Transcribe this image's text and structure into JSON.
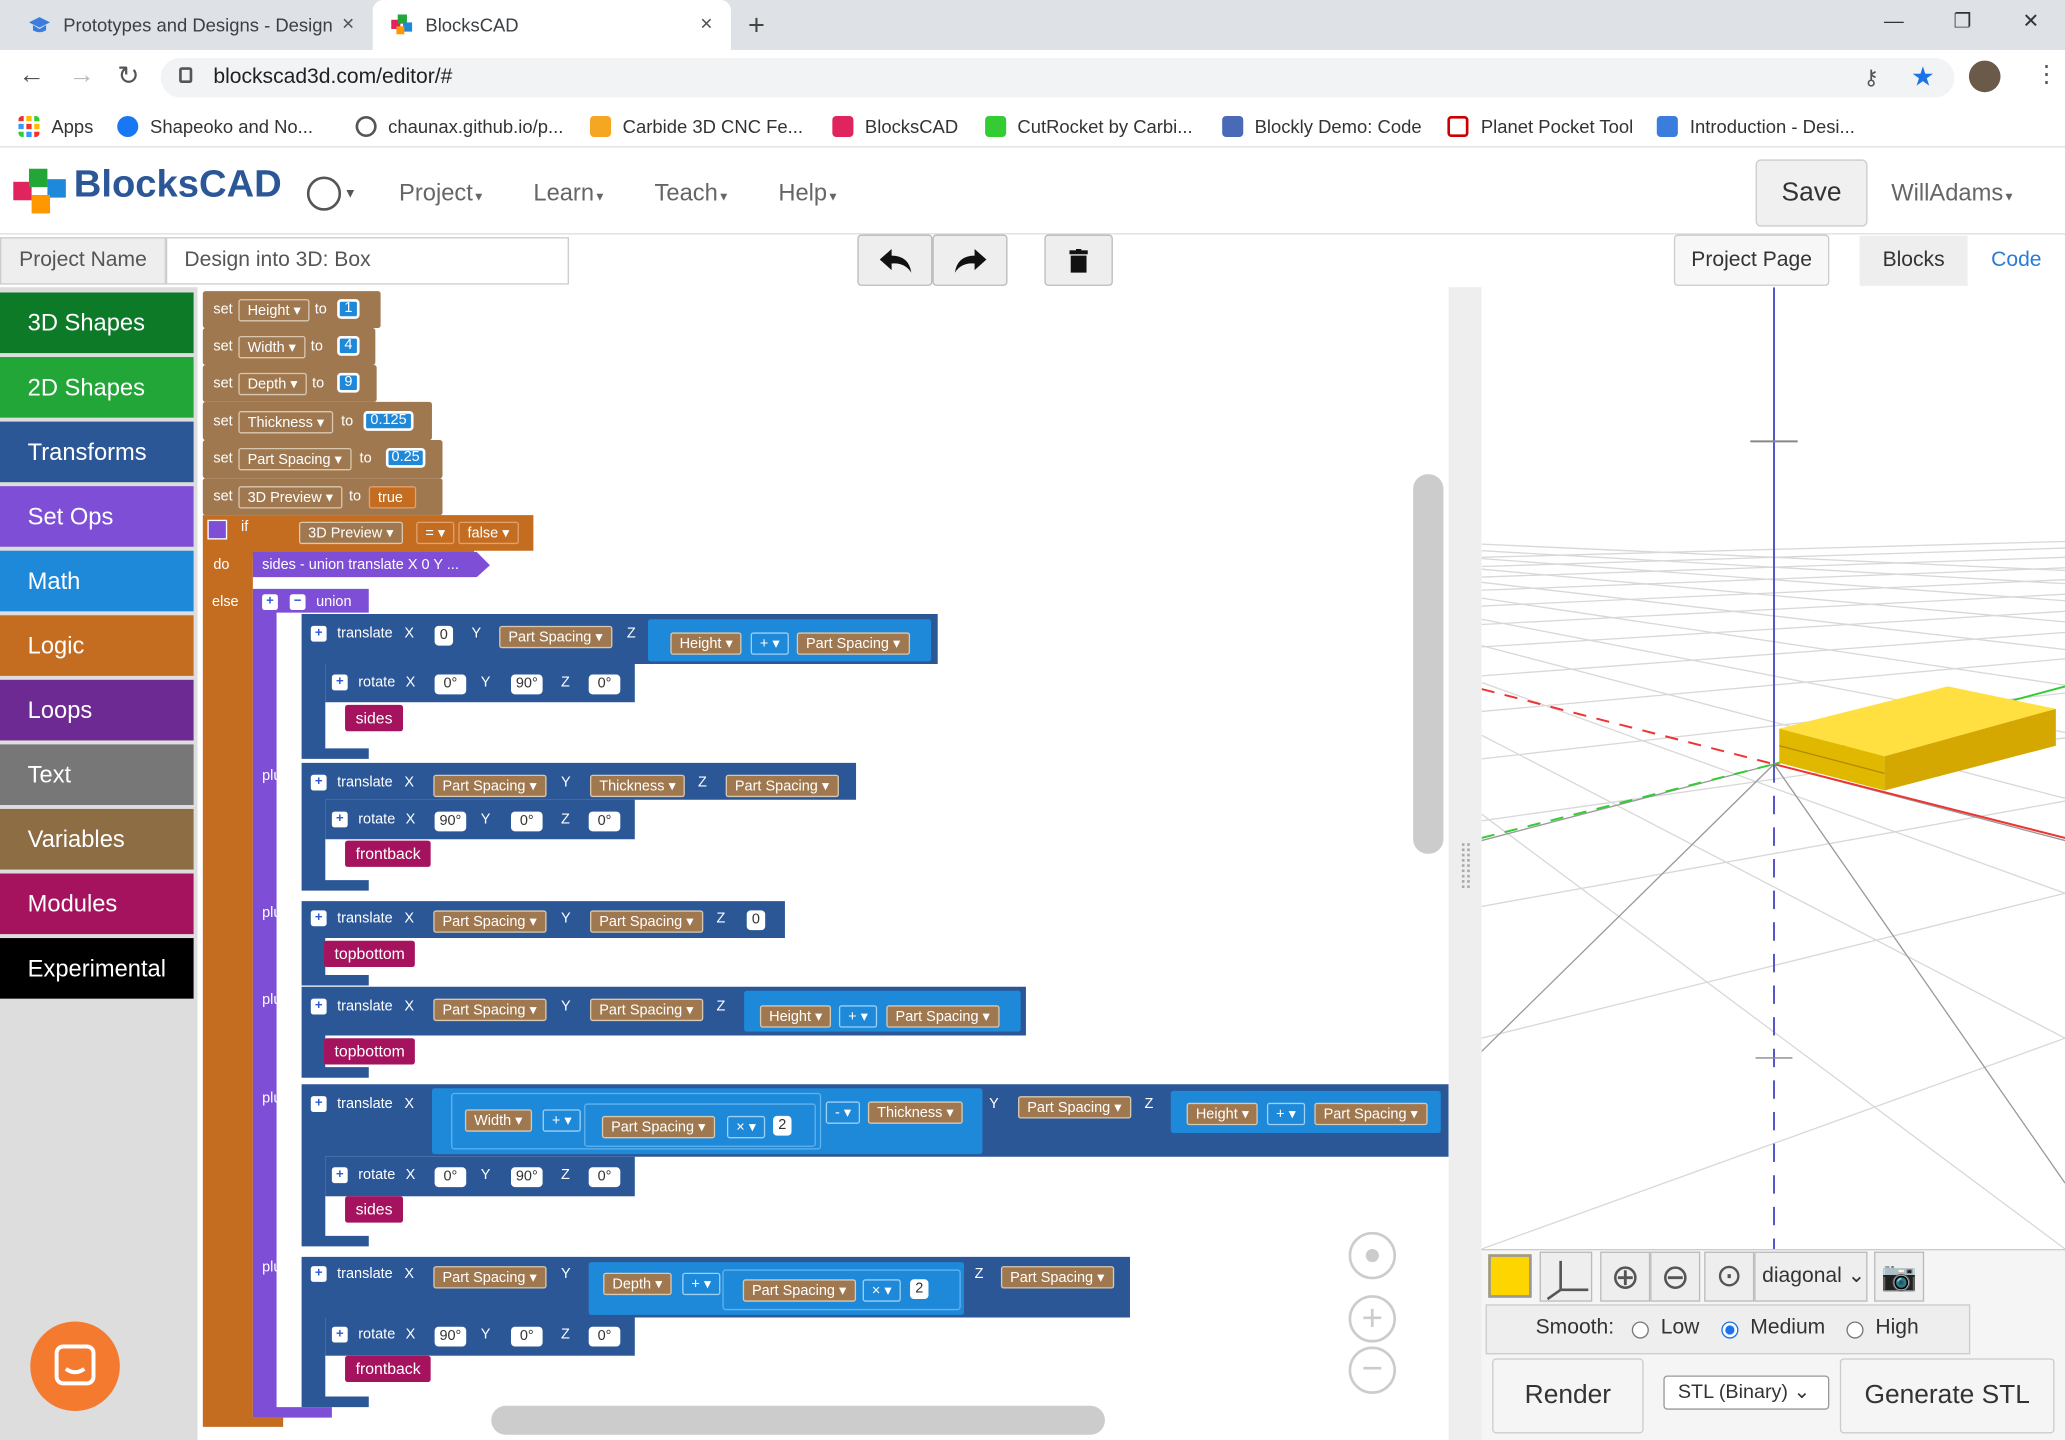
{
  "browser": {
    "tabs": [
      {
        "label": "Prototypes and Designs - Design",
        "close": "×"
      },
      {
        "label": "BlocksCAD",
        "close": "×"
      }
    ],
    "new_tab": "+",
    "url": "blockscad3d.com/editor/#",
    "bookmarks": [
      "Apps",
      "Shapeoko and No...",
      "chaunax.github.io/p...",
      "Carbide 3D CNC Fe...",
      "BlocksCAD",
      "CutRocket by Carbi...",
      "Blockly Demo: Code",
      "Planet Pocket Tool",
      "Introduction - Desi..."
    ]
  },
  "app": {
    "logo": "BlocksCAD",
    "menu": [
      "Project",
      "Learn",
      "Teach",
      "Help"
    ],
    "save": "Save",
    "user": "WillAdams",
    "project_name_label": "Project Name",
    "project_name": "Design into 3D: Box",
    "project_page": "Project Page",
    "view_tabs": [
      "Blocks",
      "Code"
    ]
  },
  "toolbox": [
    {
      "label": "3D Shapes",
      "color": "#0d7a28"
    },
    {
      "label": "2D Shapes",
      "color": "#21a637"
    },
    {
      "label": "Transforms",
      "color": "#2b5797"
    },
    {
      "label": "Set Ops",
      "color": "#7e4fd6"
    },
    {
      "label": "Math",
      "color": "#1e88d9"
    },
    {
      "label": "Logic",
      "color": "#c46d21"
    },
    {
      "label": "Loops",
      "color": "#6e2a93"
    },
    {
      "label": "Text",
      "color": "#777777"
    },
    {
      "label": "Variables",
      "color": "#8c6d44"
    },
    {
      "label": "Modules",
      "color": "#a5135e"
    },
    {
      "label": "Experimental",
      "color": "#000000"
    }
  ],
  "blocks": {
    "set": "set",
    "to": "to",
    "vars": [
      {
        "name": "Height",
        "value": "1"
      },
      {
        "name": "Width",
        "value": "4"
      },
      {
        "name": "Depth",
        "value": "9"
      },
      {
        "name": "Thickness",
        "value": "0.125"
      },
      {
        "name": "Part Spacing",
        "value": "0.25"
      },
      {
        "name": "3D Preview",
        "value": "true"
      }
    ],
    "if": "if",
    "do": "do",
    "else": "else",
    "plus": "plus",
    "cond_var": "3D Preview",
    "cond_op": "=",
    "cond_val": "false",
    "do_call": "sides - union translate X 0 Y ...",
    "union": "union",
    "translate": "translate",
    "rotate": "rotate",
    "X": "X",
    "Y": "Y",
    "Z": "Z",
    "zero": "0",
    "two": "2",
    "deg0": "0°",
    "deg90": "90°",
    "op_plus": "+",
    "op_minus": "-",
    "op_times": "×",
    "height": "Height",
    "width": "Width",
    "depth": "Depth",
    "thickness": "Thickness",
    "spacing": "Part Spacing",
    "modules": {
      "sides": "sides",
      "frontback": "frontback",
      "topbottom": "topbottom"
    }
  },
  "render": {
    "view": "diagonal",
    "smooth_label": "Smooth:",
    "smooth_options": [
      "Low",
      "Medium",
      "High"
    ],
    "smooth_selected": "Medium",
    "render_btn": "Render",
    "format": "STL (Binary)",
    "generate_btn": "Generate STL",
    "model_color": "#ffd500"
  }
}
